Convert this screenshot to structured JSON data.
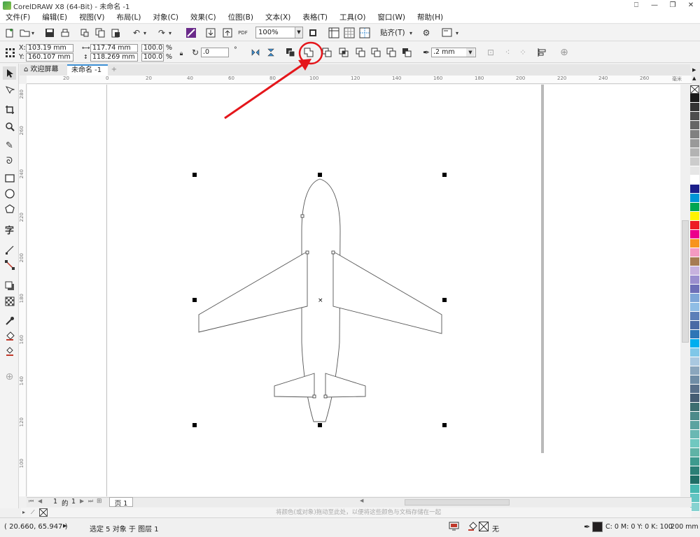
{
  "window": {
    "title": "CorelDRAW X8 (64-Bit) - 未命名 -1",
    "controls": [
      "⎕",
      "—",
      "❐",
      "✕"
    ]
  },
  "menu": [
    "文件(F)",
    "编辑(E)",
    "视图(V)",
    "布局(L)",
    "对象(C)",
    "效果(C)",
    "位图(B)",
    "文本(X)",
    "表格(T)",
    "工具(O)",
    "窗口(W)",
    "帮助(H)"
  ],
  "toolbar": {
    "zoom": "100%",
    "pdf_label": "PDF",
    "snap_label": "贴齐(T)"
  },
  "property_bar": {
    "x_label": "X:",
    "x_value": "103.19 mm",
    "y_label": "Y:",
    "y_value": "160.107 mm",
    "width_value": "117.74 mm",
    "height_value": "118.269 mm",
    "scale_x": "100.0",
    "scale_y": "100.0",
    "percent": "%",
    "rotation": ".0",
    "rotation_unit": "°",
    "outline_width": ".2 mm"
  },
  "tabs": {
    "welcome": "欢迎屏幕",
    "document": "未命名 -1",
    "add": "+"
  },
  "ruler": {
    "h_ticks": [
      "20",
      "0",
      "20",
      "40",
      "60",
      "80",
      "100",
      "120",
      "140",
      "160",
      "180",
      "200",
      "220",
      "240",
      "260"
    ],
    "h_unit": "毫米",
    "v_ticks": [
      "280",
      "260",
      "240",
      "220",
      "200",
      "180",
      "160",
      "140",
      "120",
      "100"
    ]
  },
  "page_nav": {
    "current": "1",
    "of": "的",
    "total": "1",
    "page_tab": "页 1"
  },
  "hint": "将颜色(或对象)拖动至此处，以便将这些颜色与文档存储在一起",
  "status": {
    "coords": "( 20.660, 65.947 )",
    "selection": "选定 5 对象 于 图层 1",
    "fill_none": "无",
    "outline_color": "C: 0 M: 0 Y: 0 K: 100",
    "outline_width": ".200 mm"
  },
  "colors": {
    "accent": "#3b8fd4",
    "annotation": "#e4161b",
    "palette": [
      "#1a1a1a",
      "#333333",
      "#4d4d4d",
      "#666666",
      "#808080",
      "#999999",
      "#b3b3b3",
      "#cccccc",
      "#e6e6e6",
      "#ffffff",
      "#1b1f8a",
      "#0096d6",
      "#00a651",
      "#fff200",
      "#ed1c24",
      "#ec008c",
      "#f7941d",
      "#f49ac1",
      "#a67c52",
      "#c7b2de",
      "#9b8fcf",
      "#6d6fb8",
      "#7ea6d8",
      "#8fbde5",
      "#5b7fb8",
      "#4a6aa5",
      "#2e75b6",
      "#00aeef",
      "#7fc7e8",
      "#a9c8e0",
      "#8aa6bd",
      "#6f8da6",
      "#58708a",
      "#455d73",
      "#3c6e71",
      "#4c8a8a",
      "#5ba3a0",
      "#6ab8b3",
      "#70c8c0",
      "#5fb3a6",
      "#3d9a8e",
      "#2b7f76",
      "#1f6e66",
      "#46b8b0",
      "#62c5c2",
      "#86d2d0"
    ]
  }
}
